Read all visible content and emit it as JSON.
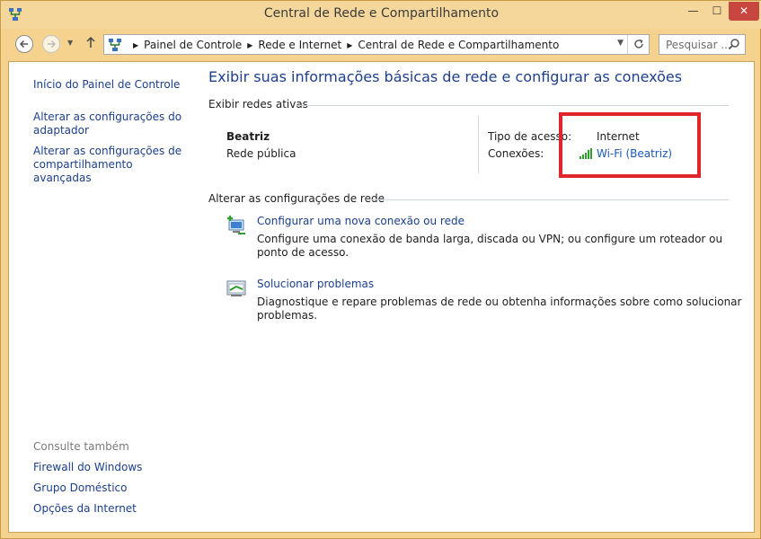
{
  "window": {
    "title": "Central de Rede e Compartilhamento",
    "buttons": {
      "minimize": "—",
      "maximize": "☐",
      "close": "✕"
    }
  },
  "nav": {
    "breadcrumb": [
      "Painel de Controle",
      "Rede e Internet",
      "Central de Rede e Compartilhamento"
    ],
    "search_placeholder": "Pesquisar ..."
  },
  "sidebar": {
    "links": [
      "Início do Painel de Controle",
      "Alterar as configurações do adaptador",
      "Alterar as configurações de compartilhamento avançadas"
    ],
    "see_also_label": "Consulte também",
    "see_also": [
      "Firewall do Windows",
      "Grupo Doméstico",
      "Opções da Internet"
    ]
  },
  "main": {
    "title": "Exibir suas informações básicas de rede e configurar as conexões",
    "active_networks_heading": "Exibir redes ativas",
    "network": {
      "name": "Beatriz",
      "type": "Rede pública",
      "access_type_label": "Tipo de acesso:",
      "access_type_value": "Internet",
      "connections_label": "Conexões:",
      "connections_value": "Wi-Fi (Beatriz)"
    },
    "change_settings_heading": "Alterar as configurações de rede",
    "tasks": [
      {
        "title": "Configurar uma nova conexão ou rede",
        "description": "Configure uma conexão de banda larga, discada ou VPN; ou configure um roteador ou ponto de acesso.",
        "icon": "new-connection-icon"
      },
      {
        "title": "Solucionar problemas",
        "description": "Diagnostique e repare problemas de rede ou obtenha informações sobre como solucionar problemas.",
        "icon": "troubleshoot-icon"
      }
    ]
  },
  "colors": {
    "frame": "#f5d38e",
    "link": "#1b3f8b",
    "title": "#1e3f8c",
    "highlight": "#e0252b",
    "close": "#c7463f"
  }
}
